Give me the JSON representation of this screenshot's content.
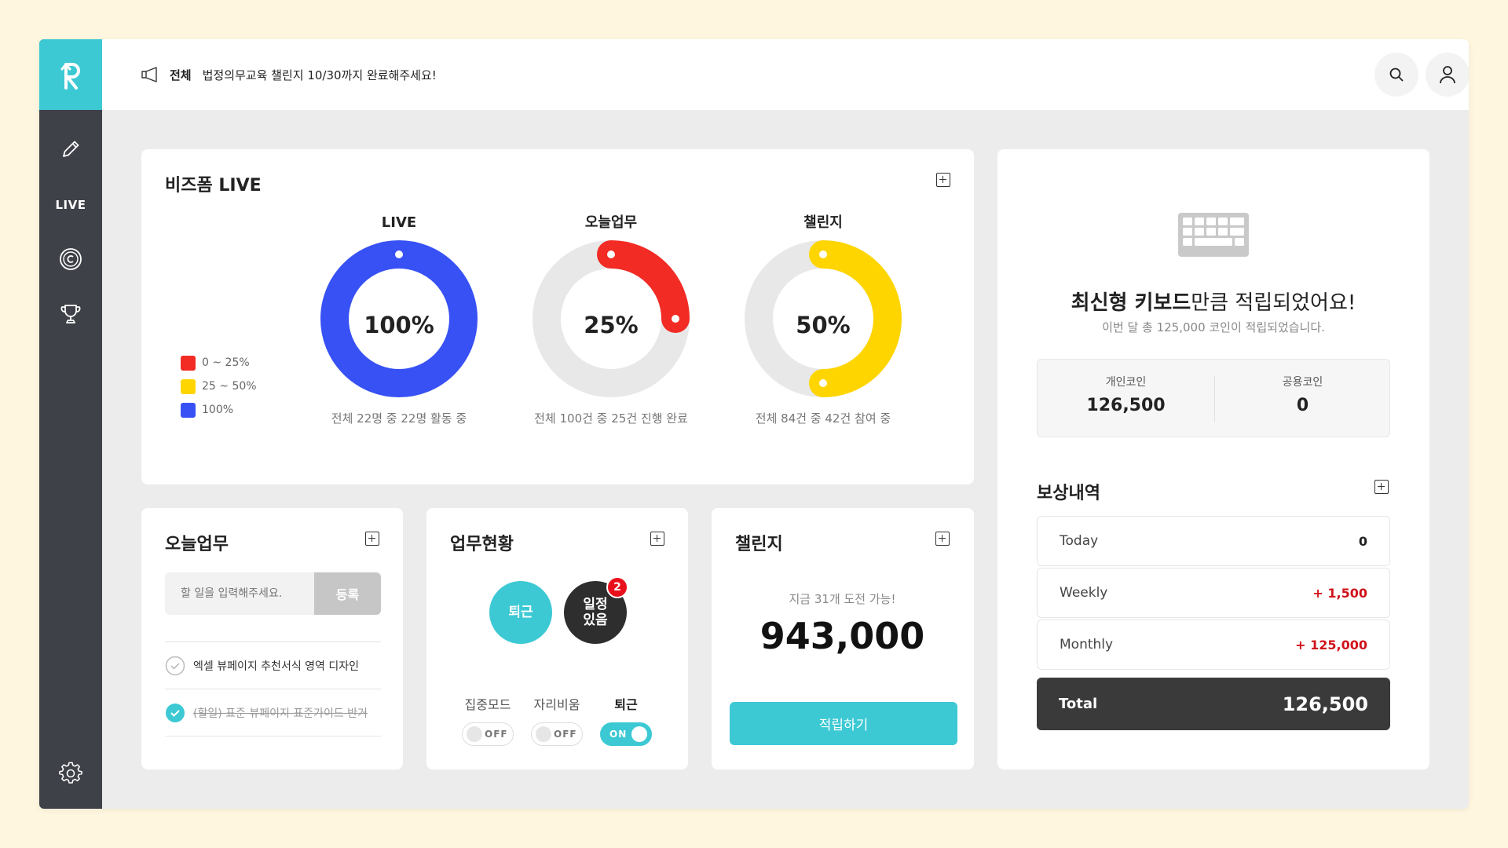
{
  "sidebar": {
    "live_label": "LIVE",
    "icons": [
      "edit-icon",
      "copyright-coin-icon",
      "trophy-icon",
      "settings-icon"
    ]
  },
  "header": {
    "notice_category": "전체",
    "notice_text": "법정의무교육 챌린지 10/30까지 완료해주세요!"
  },
  "live_card": {
    "title": "비즈폼 LIVE",
    "legend": [
      {
        "label": "0 ~ 25%",
        "color": "#f22b24"
      },
      {
        "label": "25 ~ 50%",
        "color": "#ffd500"
      },
      {
        "label": "100%",
        "color": "#3751f5"
      }
    ],
    "donuts": [
      {
        "label": "LIVE",
        "value": "100%",
        "fraction": 1.0,
        "color": "#3751f5",
        "caption": "전체 22명 중 22명 활동 중"
      },
      {
        "label": "오늘업무",
        "value": "25%",
        "fraction": 0.25,
        "color": "#f22b24",
        "caption": "전체 100건 중 25건 진행 완료"
      },
      {
        "label": "챌린지",
        "value": "50%",
        "fraction": 0.5,
        "color": "#ffd500",
        "caption": "전체 84건 중 42건 참여 중"
      }
    ]
  },
  "todo_card": {
    "title": "오늘업무",
    "input_placeholder": "할 일을 입력해주세요.",
    "submit_label": "등록",
    "items": [
      {
        "text": "엑셀 뷰페이지 추천서식 영역 디자인",
        "done": false
      },
      {
        "text": "(할일) 표준 뷰페이지 표준가이드 반거",
        "done": true
      }
    ]
  },
  "status_card": {
    "title": "업무현황",
    "leave_label": "퇴근",
    "schedule_label_line1": "일정",
    "schedule_label_line2": "있음",
    "schedule_badge": "2",
    "toggles": [
      {
        "label": "집중모드",
        "state": "OFF",
        "on": false
      },
      {
        "label": "자리비움",
        "state": "OFF",
        "on": false
      },
      {
        "label": "퇴근",
        "state": "ON",
        "on": true
      }
    ]
  },
  "challenge_card": {
    "title": "챌린지",
    "subtitle": "지금 31개 도전 가능!",
    "amount": "943,000",
    "button_label": "적립하기"
  },
  "reward_card": {
    "headline_bold": "최신형 키보드",
    "headline_rest": "만큼 적립되었어요!",
    "subtext": "이번 달 총 125,000 코인이 적립되었습니다.",
    "personal_coin_label": "개인코인",
    "personal_coin_value": "126,500",
    "shared_coin_label": "공용코인",
    "shared_coin_value": "0",
    "history_title": "보상내역",
    "rows": [
      {
        "name": "Today",
        "amount": "0",
        "plus": false
      },
      {
        "name": "Weekly",
        "amount": "+ 1,500",
        "plus": true
      },
      {
        "name": "Monthly",
        "amount": "+ 125,000",
        "plus": true
      }
    ],
    "total_label": "Total",
    "total_value": "126,500"
  },
  "colors": {
    "accent": "#3cc9d4",
    "sidebar": "#3f4148",
    "red": "#f22b24",
    "yellow": "#ffd500",
    "blue": "#3751f5"
  }
}
